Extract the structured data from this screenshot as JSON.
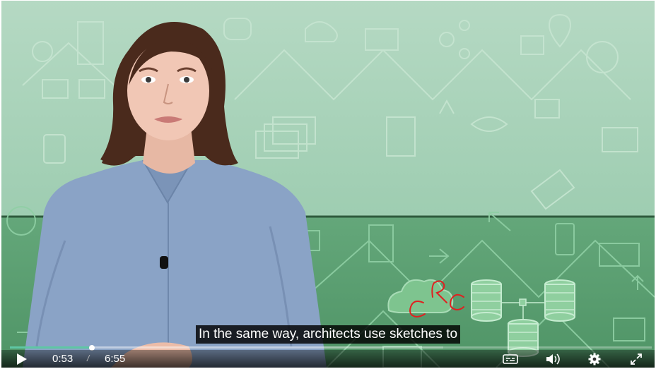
{
  "caption": {
    "text": "In the same way, architects use sketches to"
  },
  "player": {
    "current_time": "0:53",
    "separator": "/",
    "duration": "6:55",
    "progress_fraction": 0.128,
    "buffered_fraction": 0.675
  },
  "icons": {
    "play": "play-icon",
    "captions": "captions-icon",
    "volume": "volume-icon",
    "settings": "gear-icon",
    "fullscreen": "fullscreen-icon"
  },
  "colors": {
    "progress": "#5ec7a4",
    "background_top": "#a8d0b6",
    "background_bottom": "#5a9e70",
    "ink": "#e02020"
  }
}
